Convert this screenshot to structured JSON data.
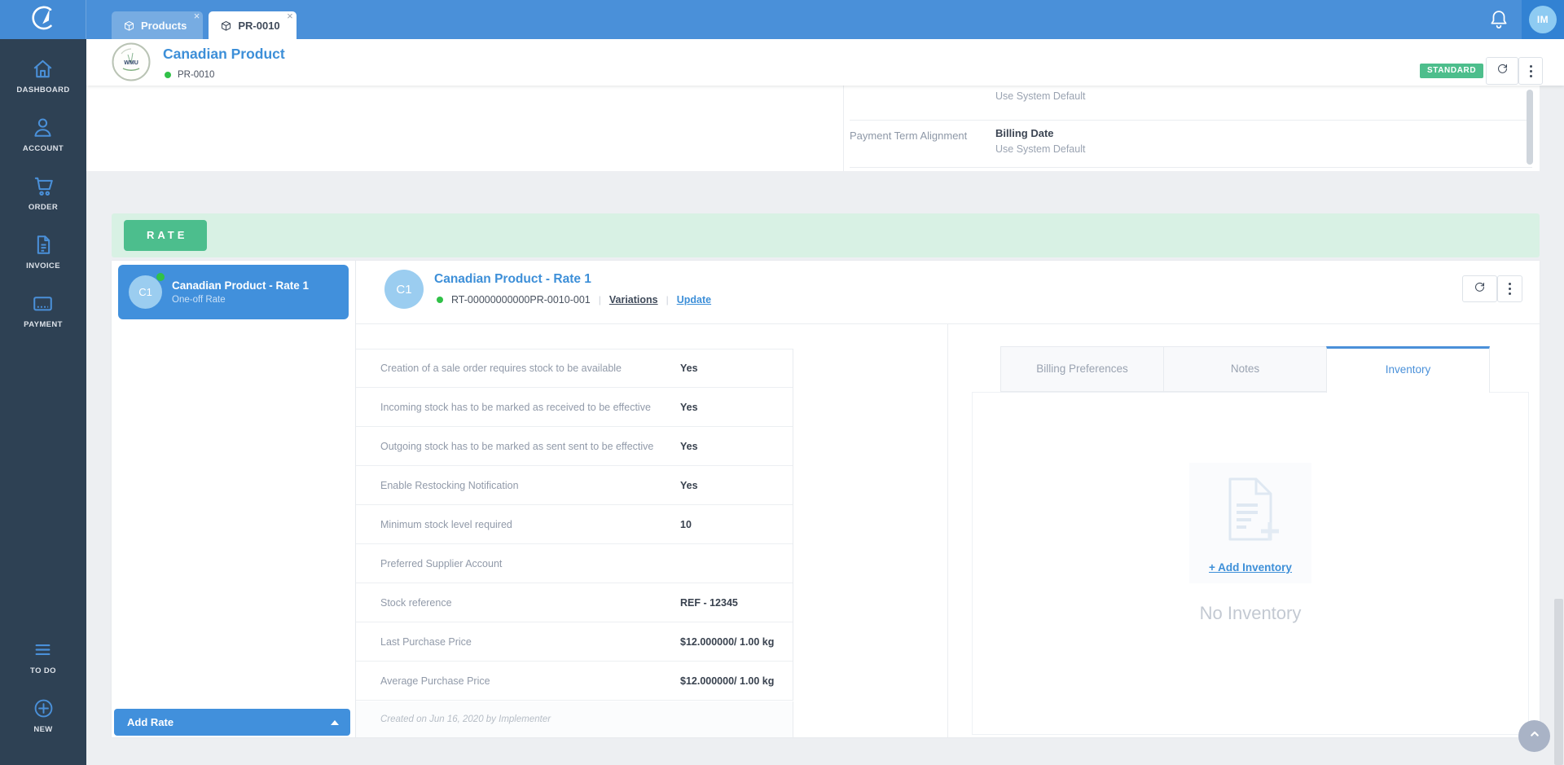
{
  "topbar": {
    "tabs": [
      {
        "label": "Products",
        "icon": "package-icon",
        "active": false
      },
      {
        "label": "PR-0010",
        "icon": "package-icon",
        "active": true
      }
    ],
    "avatar_initials": "IM"
  },
  "sidebar": {
    "items": [
      {
        "label": "DASHBOARD",
        "icon": "home-icon"
      },
      {
        "label": "ACCOUNT",
        "icon": "user-icon"
      },
      {
        "label": "ORDER",
        "icon": "cart-icon"
      },
      {
        "label": "INVOICE",
        "icon": "invoice-icon"
      },
      {
        "label": "PAYMENT",
        "icon": "card-icon"
      }
    ],
    "bottom_items": [
      {
        "label": "TO DO",
        "icon": "menu-icon"
      },
      {
        "label": "NEW",
        "icon": "plus-circle-icon"
      }
    ]
  },
  "header": {
    "title": "Canadian Product",
    "code": "PR-0010",
    "badge": "STANDARD",
    "logo_text": "WMU"
  },
  "scrolled_card": {
    "partial_value": "Use System Default",
    "rows": [
      {
        "label": "Payment Term Alignment",
        "value": "Billing Date",
        "sub": "Use System Default"
      }
    ]
  },
  "rate_section": {
    "banner_label": "RATE",
    "rates": [
      {
        "initials": "C1",
        "title": "Canadian Product - Rate 1",
        "subtitle": "One-off Rate",
        "selected": true
      }
    ],
    "add_rate_label": "Add Rate",
    "detail": {
      "initials": "C1",
      "title": "Canadian Product - Rate 1",
      "code": "RT-00000000000PR-0010-001",
      "link_variations": "Variations",
      "link_update": "Update",
      "rows": [
        {
          "label": "Creation of a sale order requires stock to be available",
          "value": "Yes"
        },
        {
          "label": "Incoming stock has to be marked as received to be effective",
          "value": "Yes"
        },
        {
          "label": "Outgoing stock has to be marked as sent sent to be effective",
          "value": "Yes"
        },
        {
          "label": "Enable Restocking Notification",
          "value": "Yes"
        },
        {
          "label": "Minimum stock level required",
          "value": "10"
        },
        {
          "label": "Preferred Supplier Account",
          "value": ""
        },
        {
          "label": "Stock reference",
          "value": "REF - 12345"
        },
        {
          "label": "Last Purchase Price",
          "value": "$12.000000/ 1.00 kg"
        },
        {
          "label": "Average Purchase Price",
          "value": "$12.000000/ 1.00 kg"
        }
      ],
      "footer": "Created on Jun 16, 2020 by Implementer"
    },
    "panel_tabs": [
      {
        "label": "Billing Preferences",
        "active": false
      },
      {
        "label": "Notes",
        "active": false
      },
      {
        "label": "Inventory",
        "active": true
      }
    ],
    "inventory_empty": {
      "add_link": "+ Add Inventory",
      "message": "No Inventory"
    }
  },
  "colors": {
    "accent_blue": "#4a90d9",
    "green": "#4dbe8c",
    "status_green": "#31c148"
  }
}
